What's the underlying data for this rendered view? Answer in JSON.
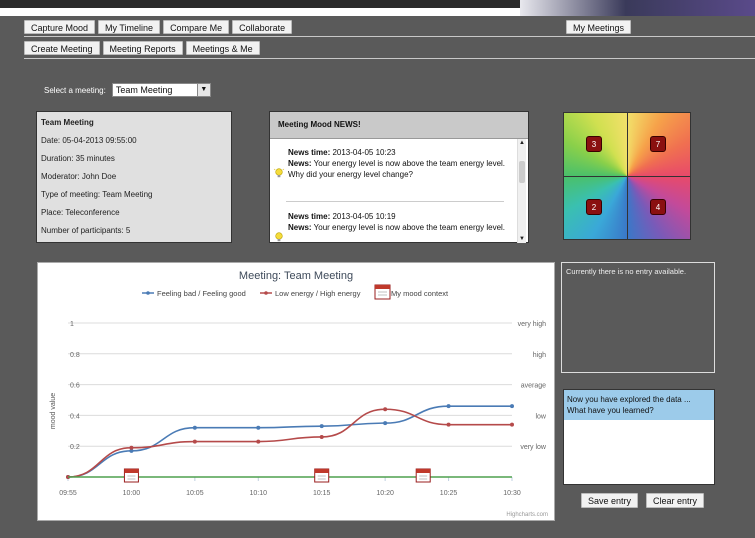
{
  "nav": {
    "primary": [
      "Capture Mood",
      "My Timeline",
      "Compare Me",
      "Collaborate"
    ],
    "right": "My Meetings",
    "secondary": [
      "Create Meeting",
      "Meeting Reports",
      "Meetings & Me"
    ]
  },
  "select": {
    "label": "Select a meeting:",
    "value": "Team Meeting"
  },
  "meeting_info": {
    "title": "Team Meeting",
    "date": "Date: 05-04-2013 09:55:00",
    "duration": "Duration: 35 minutes",
    "moderator": "Moderator: John Doe",
    "type": "Type of meeting: Team Meeting",
    "place": "Place: Teleconference",
    "participants": "Number of participants: 5"
  },
  "news": {
    "header": "Meeting Mood NEWS!",
    "items": [
      {
        "time_label": "News time:",
        "time": " 2013-04-05 10:23",
        "news_label": "News:",
        "text": " Your energy level is now above the team energy level.",
        "question": "Why did your energy level change?"
      },
      {
        "time_label": "News time:",
        "time": " 2013-04-05 10:19",
        "news_label": "News:",
        "text": " Your energy level is now above the team energy level."
      }
    ]
  },
  "mood_grid": {
    "counts": [
      "3",
      "7",
      "2",
      "4"
    ]
  },
  "chart_data": {
    "type": "line",
    "title": "Meeting: Team Meeting",
    "x": [
      "09:55",
      "10:00",
      "10:05",
      "10:10",
      "10:15",
      "10:20",
      "10:25",
      "10:30"
    ],
    "series": [
      {
        "name": "Feeling bad / Feeling good",
        "color": "#4a7bb5",
        "values": [
          0.0,
          0.17,
          0.32,
          0.32,
          0.33,
          0.35,
          0.46,
          0.46
        ]
      },
      {
        "name": "Low energy / High energy",
        "color": "#b54a4a",
        "values": [
          0.0,
          0.19,
          0.23,
          0.23,
          0.26,
          0.44,
          0.34,
          0.34
        ]
      },
      {
        "name": "My mood context",
        "color": "#4fa04f",
        "values": [
          0,
          0,
          0,
          0,
          0,
          0,
          0,
          0
        ]
      }
    ],
    "context_markers_x": [
      "10:00",
      "10:15",
      "10:23"
    ],
    "ylabel": "mood value",
    "y_ticks": [
      "0",
      "0.2",
      "0.4",
      "0.6",
      "0.8",
      "1"
    ],
    "y_ticks_shown": [
      "0.2",
      "0.4",
      "0.6",
      "0.8",
      "1"
    ],
    "y_right_labels": [
      "very low",
      "low",
      "average",
      "high",
      "very high"
    ],
    "ylim": [
      0,
      1
    ],
    "credit": "Highcharts.com"
  },
  "side_box": {
    "text": "Currently there is no entry available."
  },
  "learn": {
    "prompt_line1": "Now you have explored the data ...",
    "prompt_line2": "What have you learned?"
  },
  "buttons": {
    "save": "Save entry",
    "clear": "Clear entry"
  },
  "colors": {
    "legend_bad_good": "#4a7bb5",
    "legend_energy": "#b54a4a",
    "context_icon": "#c0392b",
    "learn_header": "#9ccbea"
  }
}
